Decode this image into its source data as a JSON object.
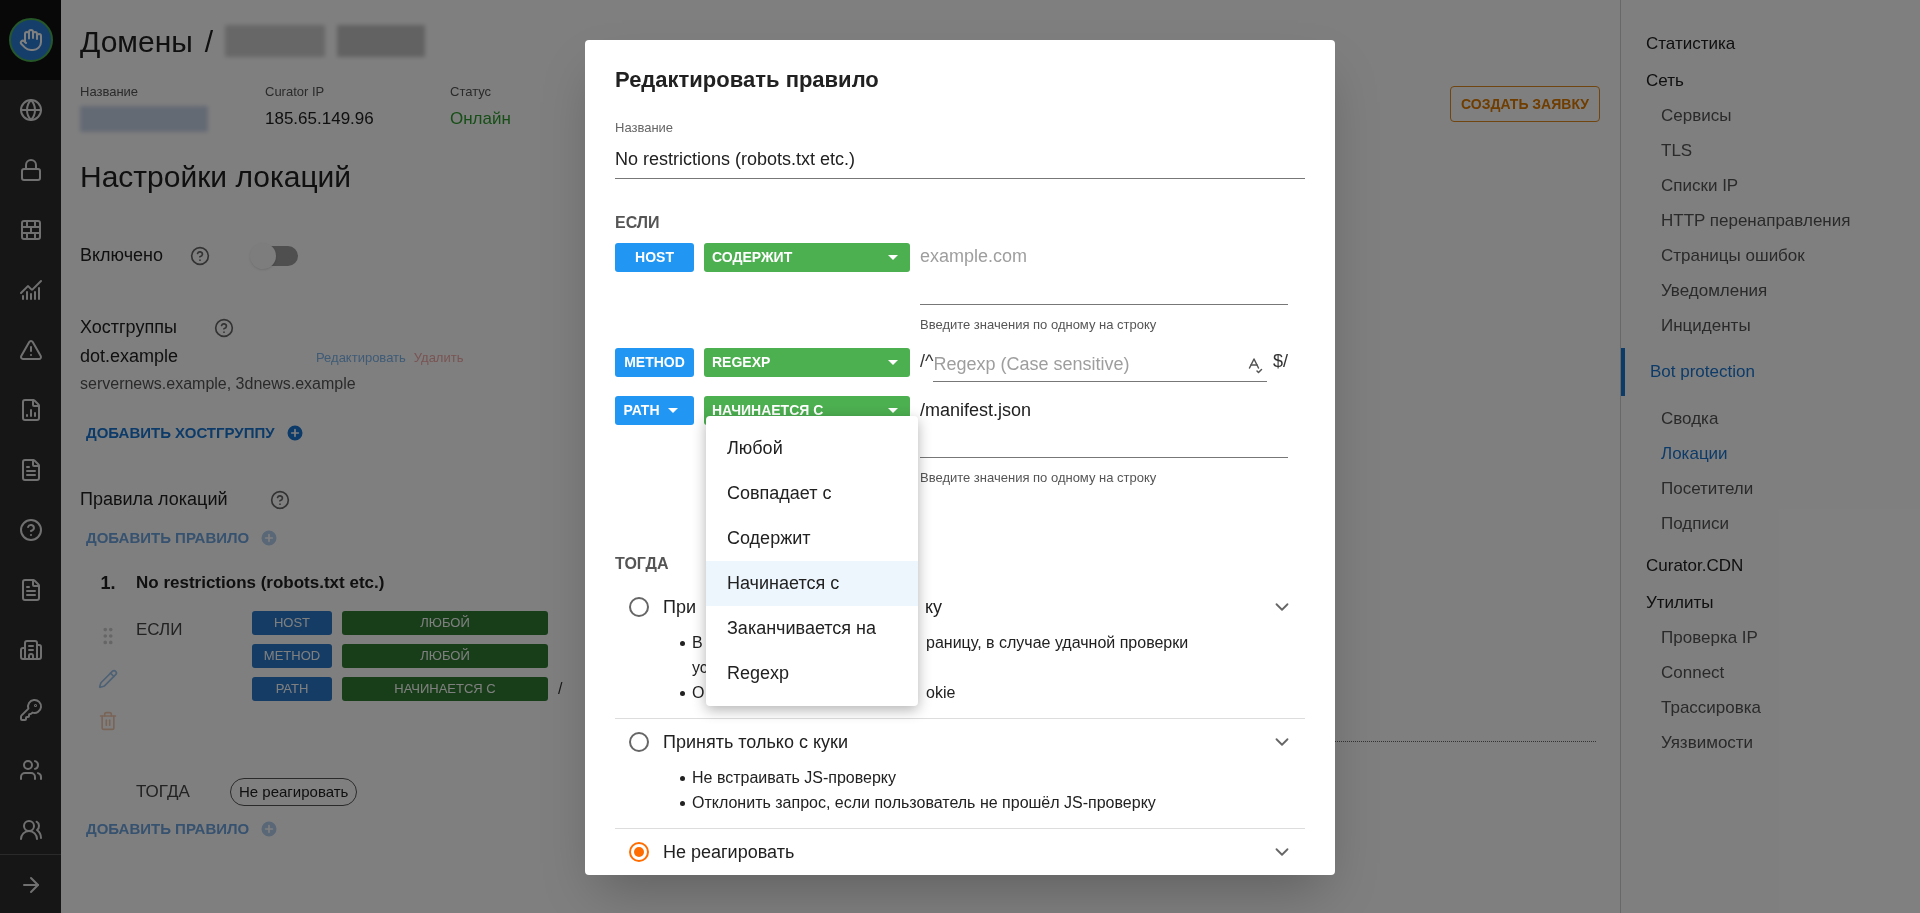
{
  "header": {
    "breadcrumb": "Домены",
    "separator": "/"
  },
  "info": [
    {
      "label": "Название",
      "kind": "redacted"
    },
    {
      "label": "Curator IP",
      "value": "185.65.149.96",
      "kind": "plain"
    },
    {
      "label": "Статус",
      "value": "Онлайн",
      "kind": "status"
    }
  ],
  "create_button": "СОЗДАТЬ ЗАЯВКУ",
  "section_title": "Настройки локаций",
  "enabled": {
    "label": "Включено",
    "on": false
  },
  "hostgroups": {
    "title": "Хостгруппы",
    "items": [
      {
        "name": "dot.example",
        "hosts": "servernews.example, 3dnews.example",
        "edit": "Редактировать",
        "delete": "Удалить"
      }
    ],
    "add": "ДОБАВИТЬ ХОСТГРУППУ"
  },
  "rules": {
    "title": "Правила локаций",
    "add_top": "ДОБАВИТЬ ПРАВИЛО",
    "add_bottom": "ДОБАВИТЬ ПРАВИЛО",
    "items": [
      {
        "number": "1.",
        "name": "No restrictions (robots.txt etc.)",
        "if_label": "ЕСЛИ",
        "then_label": "ТОГДА",
        "action": "Не реагировать",
        "conditions": [
          {
            "field": "HOST",
            "op": "ЛЮБОЙ"
          },
          {
            "field": "METHOD",
            "op": "ЛЮБОЙ"
          },
          {
            "field": "PATH",
            "op": "НАЧИНАЕТСЯ С",
            "value": "/"
          }
        ]
      }
    ]
  },
  "sidebar": {
    "groups": [
      {
        "title": "Статистика",
        "selected": false
      },
      {
        "title": "Сеть",
        "selected": false,
        "children": [
          {
            "label": "Сервисы",
            "selected": false
          },
          {
            "label": "TLS",
            "selected": false
          },
          {
            "label": "Списки IP",
            "selected": false
          },
          {
            "label": "HTTP перенаправления",
            "selected": false
          },
          {
            "label": "Страницы ошибок",
            "selected": false
          },
          {
            "label": "Уведомления",
            "selected": false
          },
          {
            "label": "Инциденты",
            "selected": false
          }
        ]
      },
      {
        "title": "Bot protection",
        "selected": true,
        "children": [
          {
            "label": "Сводка",
            "selected": false
          },
          {
            "label": "Локации",
            "selected": true
          },
          {
            "label": "Посетители",
            "selected": false
          },
          {
            "label": "Подписи",
            "selected": false
          }
        ]
      },
      {
        "title": "Curator.CDN",
        "selected": false
      },
      {
        "title": "Утилиты",
        "selected": false,
        "children": [
          {
            "label": "Проверка IP",
            "selected": false
          },
          {
            "label": "Connect",
            "selected": false
          },
          {
            "label": "Трассировка",
            "selected": false
          },
          {
            "label": "Уязвимости",
            "selected": false
          }
        ]
      }
    ]
  },
  "dialog": {
    "title": "Редактировать правило",
    "name_field": {
      "label": "Название",
      "value": "No restrictions (robots.txt etc.)"
    },
    "if_label": "ЕСЛИ",
    "conditions": [
      {
        "kind": "list",
        "field": "HOST",
        "field_menu": false,
        "op": "СОДЕРЖИТ",
        "placeholder": "example.com",
        "helper": "Введите значения по одному на строку"
      },
      {
        "kind": "regexp",
        "field": "METHOD",
        "field_menu": false,
        "op": "REGEXP",
        "prefix": "/^",
        "placeholder": "Regexp (Case sensitive)",
        "suffix": "$/"
      },
      {
        "kind": "list",
        "field": "PATH",
        "field_menu": true,
        "op": "НАЧИНАЕТСЯ С",
        "value": "/manifest.json",
        "helper": "Введите значения по одному на строку"
      }
    ],
    "op_menu": {
      "items": [
        {
          "label": "Любой",
          "selected": false
        },
        {
          "label": "Совпадает с",
          "selected": false
        },
        {
          "label": "Содержит",
          "selected": false
        },
        {
          "label": "Начинается с",
          "selected": true
        },
        {
          "label": "Заканчивается на",
          "selected": false
        },
        {
          "label": "Regexp",
          "selected": false
        }
      ]
    },
    "then_label": "ТОГДА",
    "actions": [
      {
        "selected": false,
        "title_parts": [
          "При",
          "ку"
        ],
        "lines": [
          {
            "kind": "bullet",
            "parts": [
              "В",
              "раницу, в случае удачной проверки"
            ]
          },
          {
            "kind": "continuation",
            "parts": [
              "ус"
            ]
          },
          {
            "kind": "bullet",
            "parts": [
              "О",
              "okie"
            ]
          }
        ]
      },
      {
        "selected": false,
        "title_parts": [
          "Принять только с куки"
        ],
        "lines": [
          {
            "kind": "bullet",
            "parts": [
              "Не встраивать JS-проверку"
            ]
          },
          {
            "kind": "bullet",
            "parts": [
              "Отклонить запрос, если пользователь не прошёл JS-проверку"
            ]
          }
        ]
      },
      {
        "selected": true,
        "title_parts": [
          "Не реагировать"
        ]
      }
    ]
  }
}
